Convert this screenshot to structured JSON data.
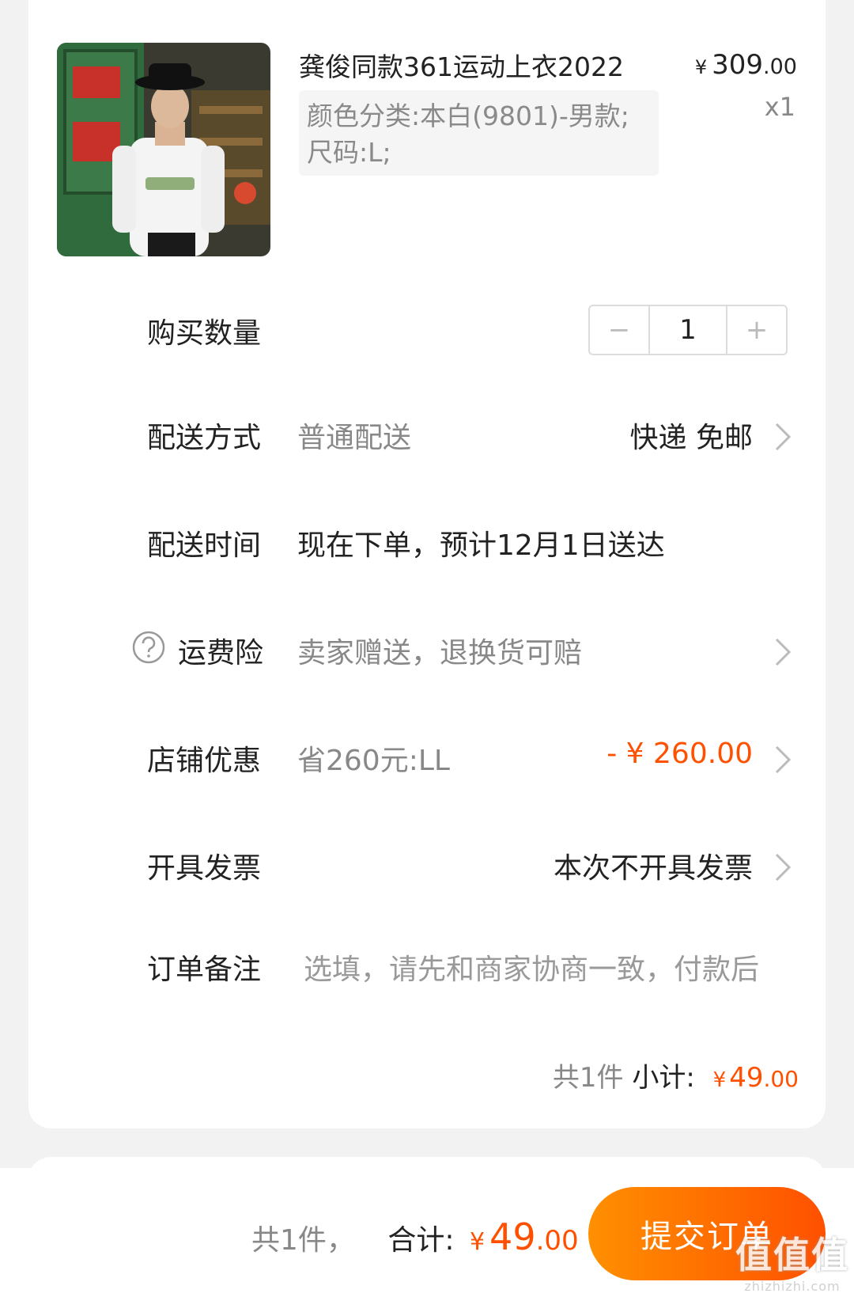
{
  "item": {
    "title": "龚俊同款361运动上衣2022",
    "sku_line1": "颜色分类:本白(9801)-男款;",
    "sku_line2": "尺码:L;",
    "price_yen": "¥",
    "price_main": "309",
    "price_cents": ".00",
    "quantity_label": "x1"
  },
  "quantity": {
    "label": "购买数量",
    "value": "1",
    "minus": "−",
    "plus": "+"
  },
  "delivery": {
    "label": "配送方式",
    "value": "普通配送",
    "right": "快递 免邮"
  },
  "delivery_time": {
    "label": "配送时间",
    "value": "现在下单，预计12月1日送达"
  },
  "insurance": {
    "label": "运费险",
    "value": "卖家赠送，退换货可赔"
  },
  "store_discount": {
    "label": "店铺优惠",
    "value": "省260元:LL",
    "amount": "- ¥ 260.00",
    "color": "#ff5000"
  },
  "invoice": {
    "label": "开具发票",
    "right": "本次不开具发票"
  },
  "note": {
    "label": "订单备注",
    "placeholder": "选填，请先和商家协商一致，付款后"
  },
  "subtotal": {
    "count": "共1件",
    "label": "小计:",
    "yen": "¥",
    "main": "49",
    "cents": ".00"
  },
  "footer": {
    "count": "共1件，",
    "label": "合计:",
    "yen": "¥",
    "main": "49",
    "cents": ".00",
    "submit": "提交订单",
    "accent": "#ff5000"
  },
  "watermark": {
    "big": "值值值",
    "small": "zhizhizhi.com"
  }
}
